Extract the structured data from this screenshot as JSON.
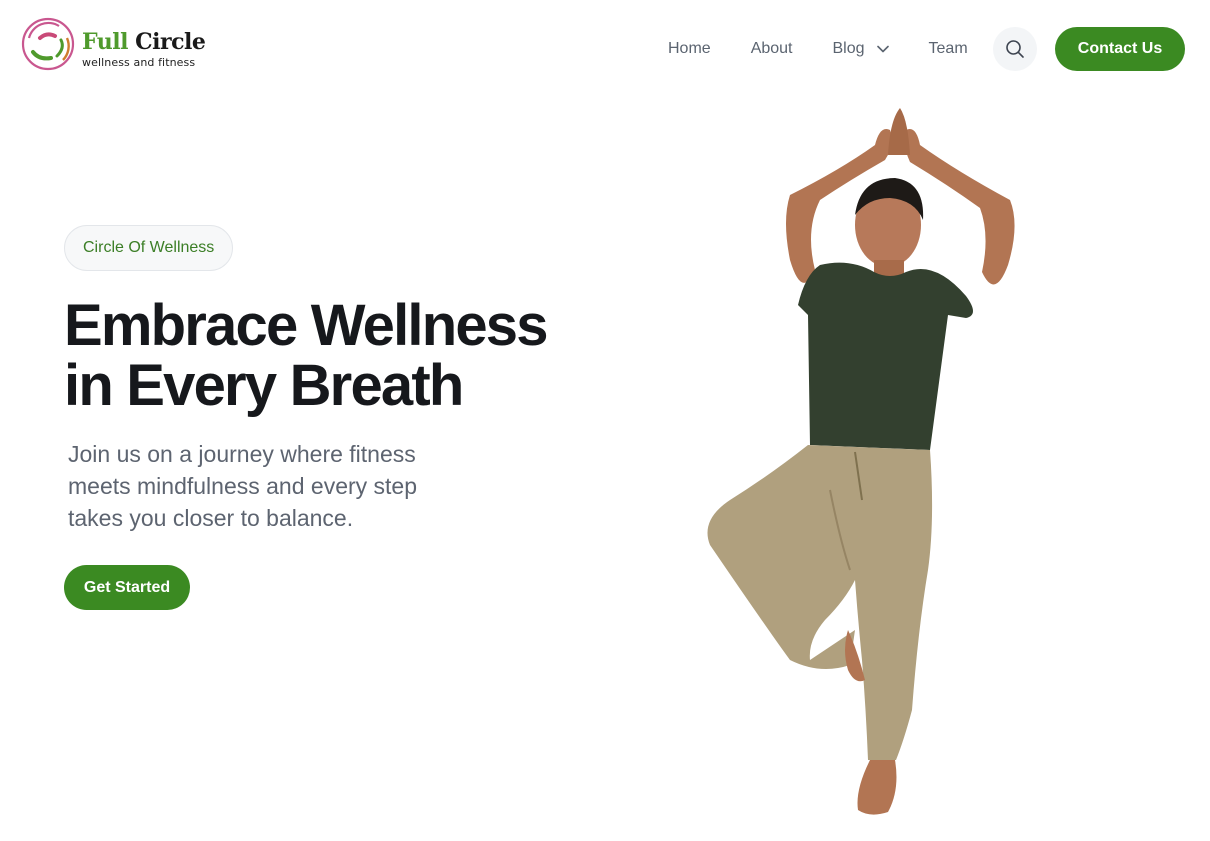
{
  "brand": {
    "name_part1": "Full",
    "name_part2": "Circle",
    "tagline": "wellness and fitness",
    "logo_icon": "circular-arrows-logo-icon"
  },
  "nav": {
    "items": [
      {
        "label": "Home"
      },
      {
        "label": "About"
      },
      {
        "label": "Blog",
        "has_dropdown": true
      },
      {
        "label": "Team"
      }
    ],
    "search_icon": "search-icon",
    "contact_label": "Contact Us"
  },
  "hero": {
    "badge": "Circle Of Wellness",
    "headline_line1": "Embrace Wellness",
    "headline_line2": "in Every Breath",
    "subtext_line1": "Join us on a journey where fitness",
    "subtext_line2": "meets mindfulness and every step",
    "subtext_line3": "takes you closer to balance.",
    "cta_label": "Get Started",
    "image": "man-in-yoga-tree-pose"
  },
  "colors": {
    "accent_green": "#3b8a22",
    "heading": "#16181c",
    "body_text": "#5d6470",
    "nav_text": "#5b6470"
  }
}
